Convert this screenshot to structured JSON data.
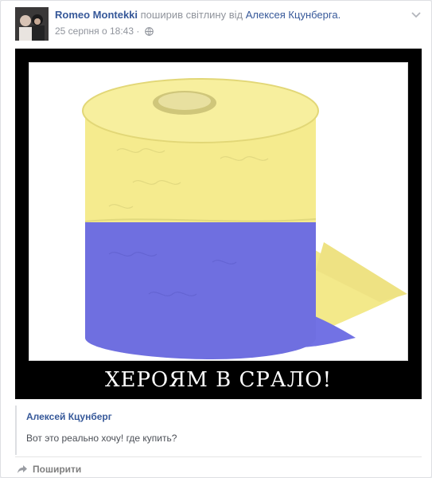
{
  "post": {
    "actor": "Romeo Montekki",
    "action": "поширив світлину від",
    "source": "Алексея Кцунберга.",
    "timestamp": "25 серпня о 18:43",
    "separator": "·"
  },
  "image": {
    "caption": "ХЕРОЯМ В СРАЛО!",
    "colors": {
      "top": "#f4ea8a",
      "bottom": "#6f6fe0",
      "frame": "#000000"
    }
  },
  "attachment": {
    "author": "Алексей Кцунберг",
    "text": "Вот это реально хочу! где купить?"
  },
  "actions": {
    "share_label": "Поширити"
  },
  "icons": {
    "privacy": "globe-icon",
    "menu": "chevron-down-icon",
    "share": "share-arrow-icon"
  }
}
